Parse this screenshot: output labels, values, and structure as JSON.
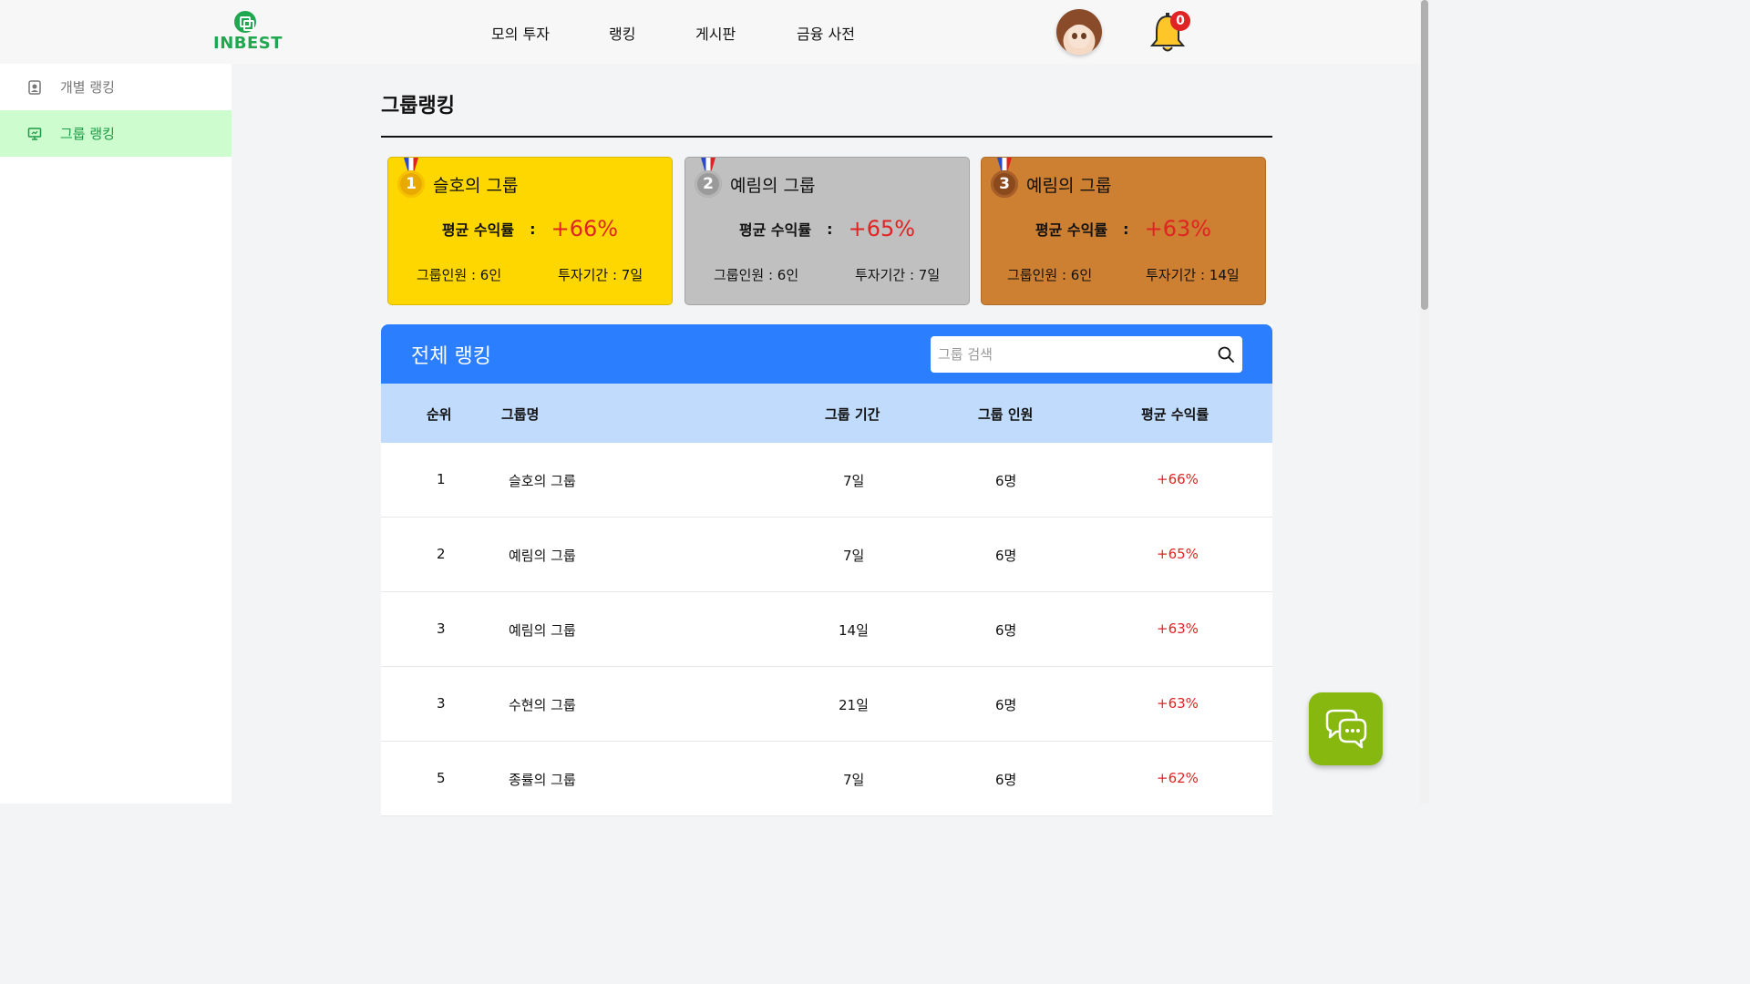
{
  "header": {
    "logo_text": "INBEST",
    "nav": [
      {
        "label": "모의 투자"
      },
      {
        "label": "랭킹"
      },
      {
        "label": "게시판"
      },
      {
        "label": "금융 사전"
      }
    ],
    "notification_count": "0",
    "logo_color": "#1fa84f"
  },
  "sidebar": {
    "items": [
      {
        "label": "개별 랭킹",
        "icon": "person-badge-icon",
        "active": false
      },
      {
        "label": "그룹 랭킹",
        "icon": "presentation-icon",
        "active": true
      }
    ],
    "active_bg": "#cdfccf",
    "active_color": "#1d9a45"
  },
  "page": {
    "title": "그룹랭킹"
  },
  "podium": [
    {
      "rank": "1",
      "name": "슬호의 그룹",
      "return_label": "평균 수익률",
      "colon": ":",
      "return_value": "+66%",
      "members": "그룹인원 : 6인",
      "period": "투자기간 : 7일",
      "bg": "#ffd700",
      "medal": "gold-medal-icon"
    },
    {
      "rank": "2",
      "name": "예림의 그룹",
      "return_label": "평균 수익률",
      "colon": ":",
      "return_value": "+65%",
      "members": "그룹인원 : 6인",
      "period": "투자기간 : 7일",
      "bg": "#c0c0c0",
      "medal": "silver-medal-icon"
    },
    {
      "rank": "3",
      "name": "예림의 그룹",
      "return_label": "평균 수익률",
      "colon": ":",
      "return_value": "+63%",
      "members": "그룹인원 : 6인",
      "period": "투자기간 : 14일",
      "bg": "#cd7f32",
      "medal": "bronze-medal-icon"
    }
  ],
  "ranking": {
    "title": "전체 랭킹",
    "search_placeholder": "그룹 검색",
    "header_color": "#2b7fff",
    "columns": [
      "순위",
      "그룹명",
      "그룹 기간",
      "그룹 인원",
      "평균 수익률"
    ],
    "rows": [
      {
        "rank": "1",
        "name": "슬호의 그룹",
        "period": "7일",
        "members": "6명",
        "return": "+66%"
      },
      {
        "rank": "2",
        "name": "예림의 그룹",
        "period": "7일",
        "members": "6명",
        "return": "+65%"
      },
      {
        "rank": "3",
        "name": "예림의 그룹",
        "period": "14일",
        "members": "6명",
        "return": "+63%"
      },
      {
        "rank": "3",
        "name": "수현의 그룹",
        "period": "21일",
        "members": "6명",
        "return": "+63%"
      },
      {
        "rank": "5",
        "name": "종률의 그룹",
        "period": "7일",
        "members": "6명",
        "return": "+62%"
      }
    ]
  },
  "chat": {
    "icon": "chat-bubbles-icon",
    "color": "#86b80f"
  }
}
